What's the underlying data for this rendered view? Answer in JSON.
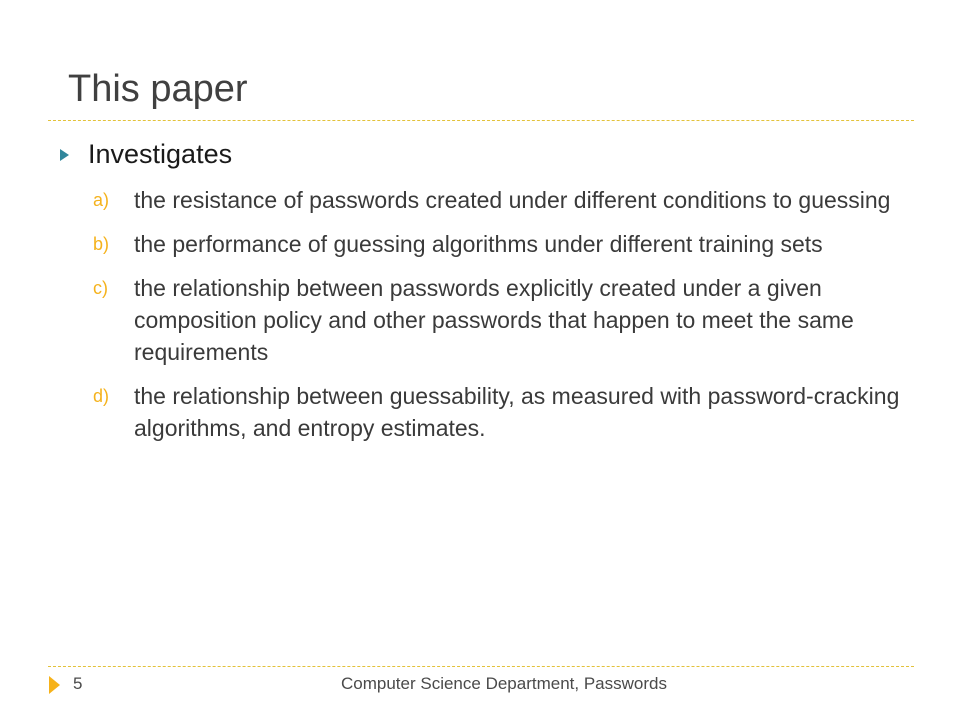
{
  "slide": {
    "title": "This paper",
    "bullet": "Investigates",
    "items": [
      {
        "marker": "a)",
        "text": "the resistance of passwords created under different conditions to guessing"
      },
      {
        "marker": "b)",
        "text": "the performance of guessing algorithms under different training sets"
      },
      {
        "marker": "c)",
        "text": "the relationship between passwords explicitly created under a given composition policy and other passwords that happen to meet the same requirements"
      },
      {
        "marker": "d)",
        "text": "the relationship between guessability, as measured with password-cracking algorithms, and entropy estimates."
      }
    ]
  },
  "footer": {
    "page_number": "5",
    "text": "Computer Science Department, Passwords"
  },
  "colors": {
    "accent_teal": "#31869b",
    "accent_gold": "#f5b21c",
    "rule": "#e3c23a"
  }
}
